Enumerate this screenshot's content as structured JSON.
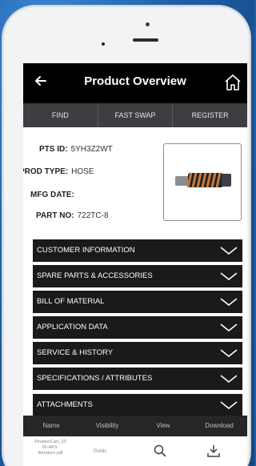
{
  "header": {
    "title": "Product Overview"
  },
  "tabs": [
    {
      "label": "FIND"
    },
    {
      "label": "FAST SWAP"
    },
    {
      "label": "REGISTER"
    }
  ],
  "details": {
    "pts_id_label": "PTS ID:",
    "pts_id_value": "5YH3Z2WT",
    "prod_type_label": "PROD TYPE:",
    "prod_type_value": "HOSE",
    "mfg_date_label": "MFG DATE:",
    "mfg_date_value": "",
    "part_no_label": "PART NO:",
    "part_no_value": "722TC-8"
  },
  "sections": [
    {
      "label": "CUSTOMER INFORMATION"
    },
    {
      "label": "SPARE PARTS & ACCESSORIES"
    },
    {
      "label": "BILL OF MATERIAL"
    },
    {
      "label": "APPLICATION DATA"
    },
    {
      "label": "SERVICE & HISTORY"
    },
    {
      "label": "SPECIFICATIONS / ATTRIBUTES"
    },
    {
      "label": "ATTACHMENTS"
    }
  ],
  "files_table": {
    "columns": [
      "Name",
      "Visibility",
      "View",
      "Download"
    ],
    "rows": [
      {
        "name": "PinationCart_23 05-AFS-literature.pdf",
        "visibility": "Public"
      }
    ]
  },
  "icons": {
    "back": "back-arrow-icon",
    "home": "home-icon",
    "chevron": "chevron-down-icon",
    "view": "search-icon",
    "download": "download-icon"
  },
  "colors": {
    "header_bg": "#000000",
    "tab_bg": "#3e3e42",
    "accordion_bg": "#1a1a1a",
    "background": "#1e5ea8"
  }
}
